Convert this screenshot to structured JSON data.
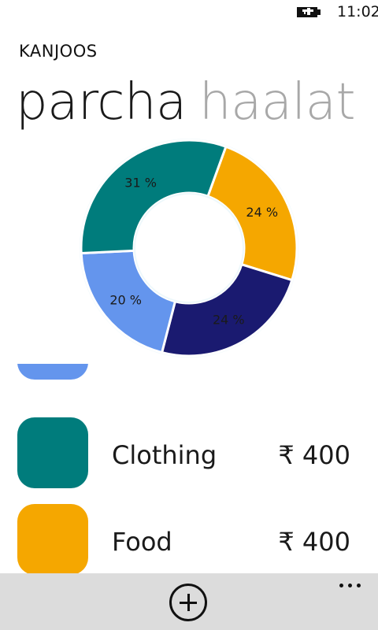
{
  "status_bar": {
    "time": "11:02",
    "battery_icon": "battery-charging-icon"
  },
  "app": {
    "title": "KANJOOS"
  },
  "pivot": {
    "items": [
      {
        "label": "parcha"
      },
      {
        "label": "haalat k"
      }
    ]
  },
  "chart_data": {
    "type": "pie",
    "labels": [
      "24 %",
      "24 %",
      "20 %",
      "31 %"
    ],
    "values": [
      24,
      24,
      20,
      31
    ],
    "colors": [
      "#F5A700",
      "#1A1A70",
      "#6495ED",
      "#007C7C"
    ],
    "donut": true
  },
  "list": {
    "items": [
      {
        "label": "Clothing",
        "amount": "₹ 400",
        "color": "#007C7C"
      },
      {
        "label": "Food",
        "amount": "₹ 400",
        "color": "#F5A700"
      }
    ],
    "partial_item_color": "#6495ED"
  },
  "app_bar": {
    "add_icon": "add-circle-icon",
    "more_icon": "ellipsis-icon"
  }
}
